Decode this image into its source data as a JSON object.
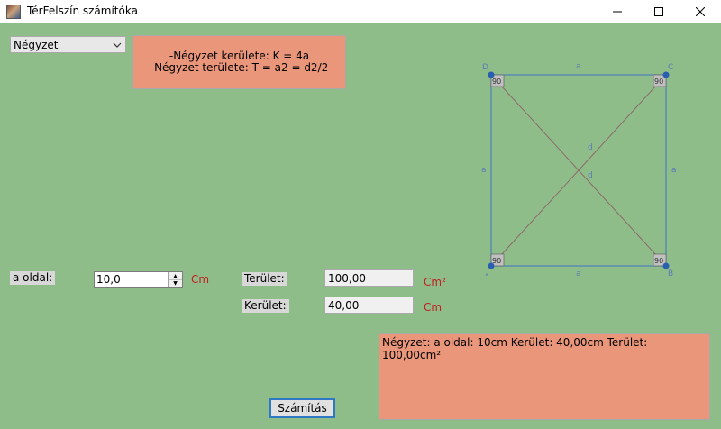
{
  "window": {
    "title": "TérFelszín számítóka"
  },
  "shape_select": {
    "value": "Négyzet"
  },
  "formula_box": {
    "line1": "-Négyzet kerülete: K = 4a",
    "line2": "-Négyzet területe: T = a2 = d2/2"
  },
  "diagram": {
    "vertex_labels": {
      "a": "A",
      "b": "B",
      "c": "C",
      "d": "D"
    },
    "side_label": "a",
    "diag_label": "d",
    "angle_label": "90"
  },
  "inputs": {
    "side": {
      "label": "a oldal:",
      "value": "10,0",
      "unit": "Cm"
    }
  },
  "outputs": {
    "area": {
      "label": "Terület:",
      "value": "100,00",
      "unit": "Cm²"
    },
    "perimeter": {
      "label": "Kerület:",
      "value": "40,00",
      "unit": "Cm"
    }
  },
  "result": {
    "text": "Négyzet: a oldal: 10cm Kerület: 40,00cm Terület: 100,00cm²"
  },
  "actions": {
    "calculate_label": "Számítás"
  },
  "colors": {
    "background": "#8fbd8a",
    "info_bg": "#e9967a",
    "unit_text": "#c02020",
    "diagram_line": "#3f74c9",
    "diagram_diag": "#8a6a6a"
  }
}
